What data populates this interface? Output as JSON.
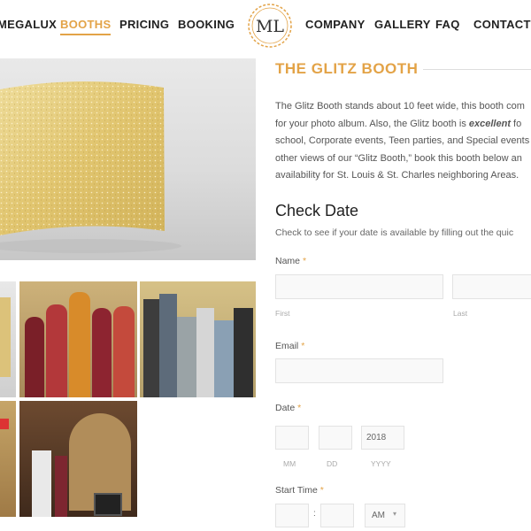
{
  "nav": {
    "brand": "MEGALUX",
    "items": [
      "BOOTHS",
      "PRICING",
      "BOOKING",
      "COMPANY",
      "GALLERY",
      "FAQ",
      "CONTACT"
    ],
    "logo_text": "ML"
  },
  "product": {
    "title": "THE GLITZ BOOTH",
    "description_lines": [
      "The Glitz Booth stands about 10 feet wide, this booth com",
      "for your photo album. Also, the Glitz booth is ",
      "school, Corporate events, Teen parties, and Special events",
      "other views of our “Glitz Booth,” book this booth below an",
      "availability for St. Louis & St. Charles neighboring Areas."
    ],
    "emphasis_word": "excellent",
    "emphasis_tail": " fo"
  },
  "form": {
    "title": "Check Date",
    "subtitle": "Check to see if your date is available by filling out the quic",
    "required_mark": "*",
    "name_label": "Name",
    "first_label": "First",
    "last_label": "Last",
    "email_label": "Email",
    "date_label": "Date",
    "year_value": "2018",
    "mm_label": "MM",
    "dd_label": "DD",
    "yyyy_label": "YYYY",
    "start_time_label": "Start Time",
    "time_separator": ":",
    "ampm_value": "AM",
    "ampm_caret": "▾"
  },
  "colors": {
    "accent": "#e3a347",
    "text": "#444444",
    "input_border": "#e3e3e3"
  }
}
